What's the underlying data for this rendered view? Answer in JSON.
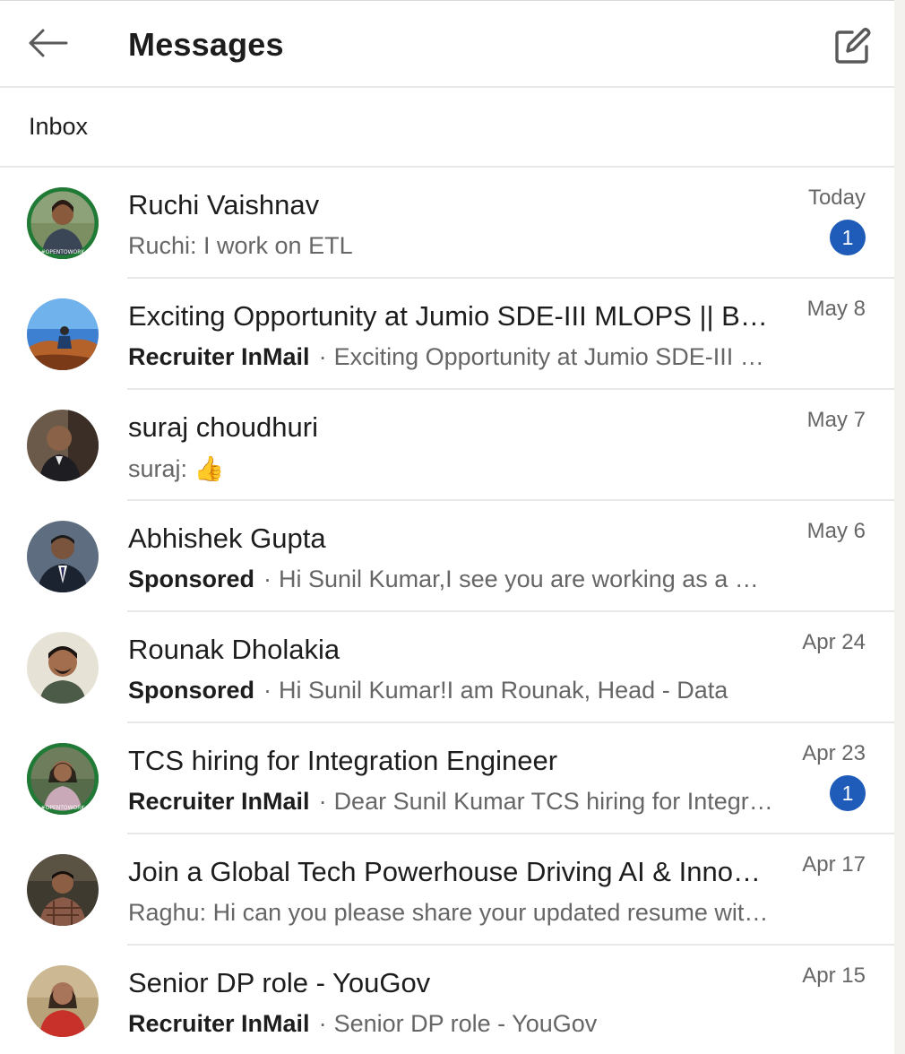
{
  "header": {
    "title": "Messages",
    "back_icon": "arrow-left-icon",
    "compose_icon": "compose-icon"
  },
  "inbox": {
    "label": "Inbox"
  },
  "colors": {
    "badge": "#1f5bb8",
    "text_primary": "#1d1d1d",
    "text_secondary": "#666666"
  },
  "conversations": [
    {
      "name": "Ruchi Vaishnav",
      "tag": "",
      "preview": "Ruchi: I work on ETL",
      "date": "Today",
      "unread": "1"
    },
    {
      "name": "Exciting Opportunity at Jumio SDE-III MLOPS || Bangalore",
      "tag": "Recruiter InMail",
      "preview": "Exciting Opportunity at Jumio SDE-III MLOPS",
      "date": "May 8",
      "unread": ""
    },
    {
      "name": "suraj choudhuri",
      "tag": "",
      "preview": "suraj: 👍",
      "date": "May 7",
      "unread": ""
    },
    {
      "name": "Abhishek Gupta",
      "tag": "Sponsored",
      "preview": "Hi Sunil Kumar,I see you are working as a Data Engineer",
      "date": "May 6",
      "unread": ""
    },
    {
      "name": "Rounak Dholakia",
      "tag": "Sponsored",
      "preview": "Hi Sunil Kumar!I am Rounak, Head - Data",
      "date": "Apr 24",
      "unread": ""
    },
    {
      "name": "TCS hiring for Integration Engineer",
      "tag": "Recruiter InMail",
      "preview": "Dear Sunil Kumar TCS hiring for Integration Engineer",
      "date": "Apr 23",
      "unread": "1"
    },
    {
      "name": "Join a Global Tech Powerhouse Driving AI & Innovation",
      "tag": "",
      "preview": "Raghu: Hi can you please share your updated resume with us",
      "date": "Apr 17",
      "unread": ""
    },
    {
      "name": "Senior DP role - YouGov",
      "tag": "Recruiter InMail",
      "preview": "Senior DP role - YouGov",
      "date": "Apr 15",
      "unread": ""
    }
  ]
}
